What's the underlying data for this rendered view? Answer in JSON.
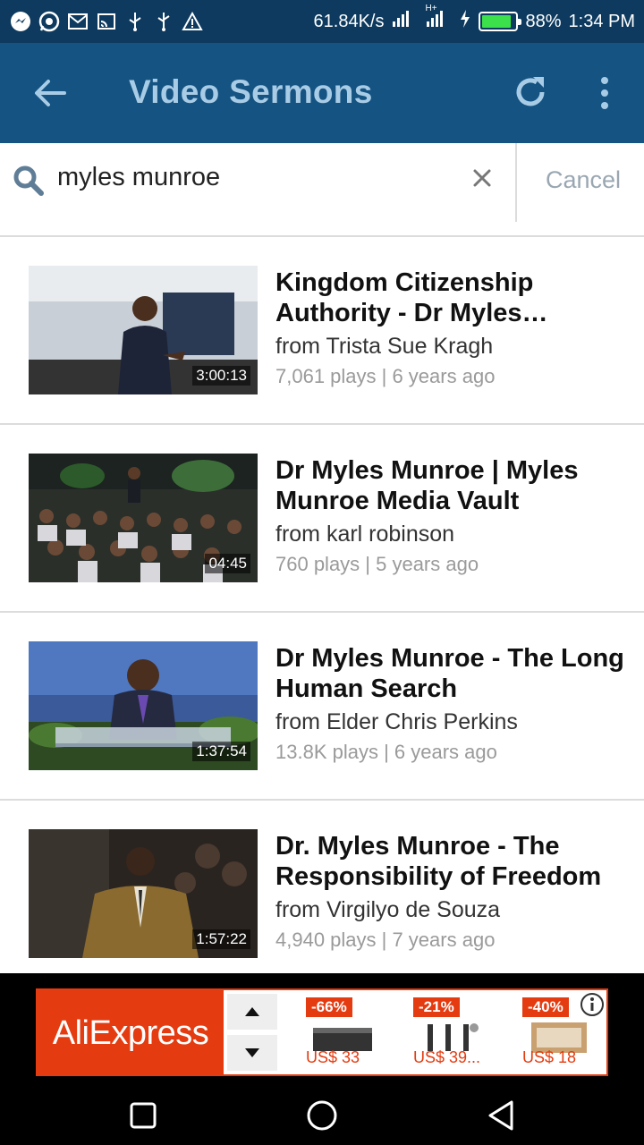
{
  "status_bar": {
    "net_speed": "61.84K/s",
    "network_type": "H+",
    "battery_pct": "88%",
    "battery_level": 0.88,
    "time": "1:34 PM",
    "notification_icons": [
      "messenger-icon",
      "whatsapp-icon",
      "gmail-icon",
      "cast-icon",
      "usb-icon",
      "usb-icon",
      "warning-icon"
    ]
  },
  "app_bar": {
    "title": "Video Sermons",
    "back_icon": "arrow-left-icon",
    "refresh_icon": "refresh-icon",
    "more_icon": "more-vert-icon"
  },
  "search": {
    "query": "myles munroe",
    "cancel_label": "Cancel"
  },
  "results": [
    {
      "title": "Kingdom Citizenship Authority - Dr Myles…",
      "from": "from Trista Sue Kragh",
      "meta": "7,061 plays | 6 years ago",
      "duration": "3:00:13"
    },
    {
      "title": "Dr Myles Munroe | Myles Munroe Media Vault",
      "from": "from karl robinson",
      "meta": "760 plays | 5 years ago",
      "duration": "04:45"
    },
    {
      "title": "Dr Myles Munroe - The Long Human Search",
      "from": "from Elder Chris Perkins",
      "meta": "13.8K plays | 6 years ago",
      "duration": "1:37:54"
    },
    {
      "title": "Dr. Myles Munroe - The Responsibility of Freedom",
      "from": "from Virgilyo de Souza",
      "meta": "4,940 plays | 7 years ago",
      "duration": "1:57:22"
    }
  ],
  "ad": {
    "brand": "AliExpress",
    "products": [
      {
        "discount": "-66%",
        "price": "US$ 33"
      },
      {
        "discount": "-21%",
        "price": "US$ 39..."
      },
      {
        "discount": "-40%",
        "price": "US$ 18"
      }
    ]
  },
  "colors": {
    "status_bar": "#0d3a5e",
    "app_bar": "#145382",
    "title_text": "#a9cce6",
    "ad_accent": "#e43b10"
  }
}
